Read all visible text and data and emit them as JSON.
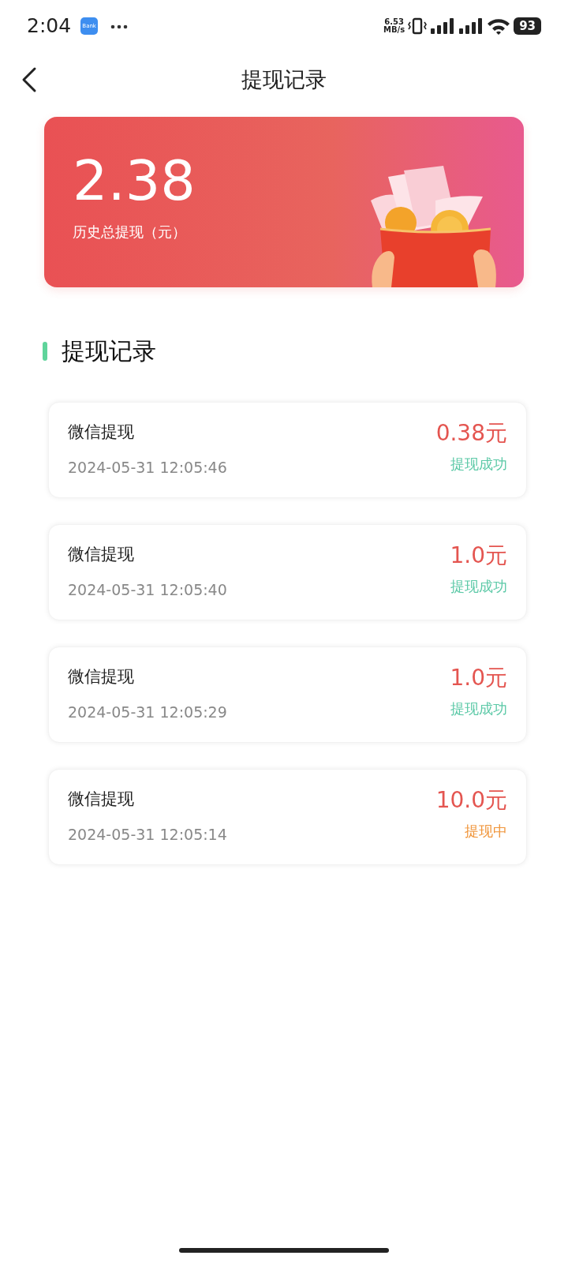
{
  "status_bar": {
    "time": "2:04",
    "app_icon_label": "Bank",
    "net_speed": "6.53",
    "net_unit": "MB/s",
    "battery": "93"
  },
  "header": {
    "title": "提现记录"
  },
  "summary": {
    "amount": "2.38",
    "label": "历史总提现（元）"
  },
  "section": {
    "title": "提现记录"
  },
  "records": [
    {
      "method": "微信提现",
      "time": "2024-05-31 12:05:46",
      "amount": "0.38元",
      "status": "提现成功",
      "kind": "success"
    },
    {
      "method": "微信提现",
      "time": "2024-05-31 12:05:40",
      "amount": "1.0元",
      "status": "提现成功",
      "kind": "success"
    },
    {
      "method": "微信提现",
      "time": "2024-05-31 12:05:29",
      "amount": "1.0元",
      "status": "提现成功",
      "kind": "success"
    },
    {
      "method": "微信提现",
      "time": "2024-05-31 12:05:14",
      "amount": "10.0元",
      "status": "提现中",
      "kind": "pending"
    }
  ]
}
